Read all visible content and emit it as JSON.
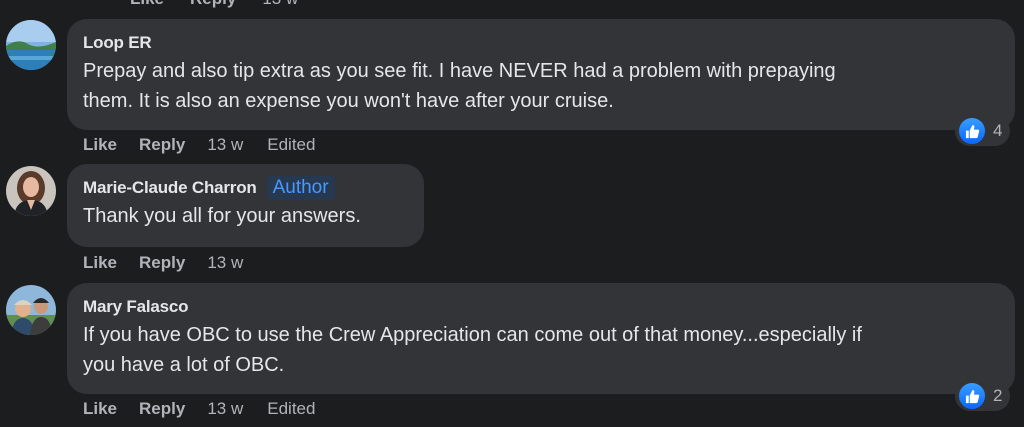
{
  "top_row": {
    "like": "Like",
    "reply": "Reply",
    "time": "13 w"
  },
  "comments": [
    {
      "author": "Loop ER",
      "badge": "",
      "text_lines": [
        "Prepay and also tip extra as you see fit. I have NEVER had a problem with prepaying",
        "them. It is also an expense you won't have after your cruise."
      ],
      "actions": {
        "like": "Like",
        "reply": "Reply",
        "time": "13 w",
        "edited": "Edited"
      },
      "reaction_count": "4"
    },
    {
      "author": "Marie-Claude Charron",
      "badge": "Author",
      "text_lines": [
        "Thank you all for your answers."
      ],
      "actions": {
        "like": "Like",
        "reply": "Reply",
        "time": "13 w"
      }
    },
    {
      "author": "Mary Falasco",
      "badge": "",
      "text_lines": [
        "If you have OBC to use the Crew Appreciation can come out of that money...especially if",
        "you have a lot of OBC."
      ],
      "actions": {
        "like": "Like",
        "reply": "Reply",
        "time": "13 w",
        "edited": "Edited"
      },
      "reaction_count": "2"
    }
  ],
  "colors": {
    "background": "#1c1d1f",
    "bubble": "#333437",
    "text": "#e4e6eb",
    "secondary_text": "#b0b3b8",
    "author_badge": "#4599ff",
    "like_blue": "#0866ff"
  },
  "icons": [
    "like-thumbs-up-icon"
  ]
}
